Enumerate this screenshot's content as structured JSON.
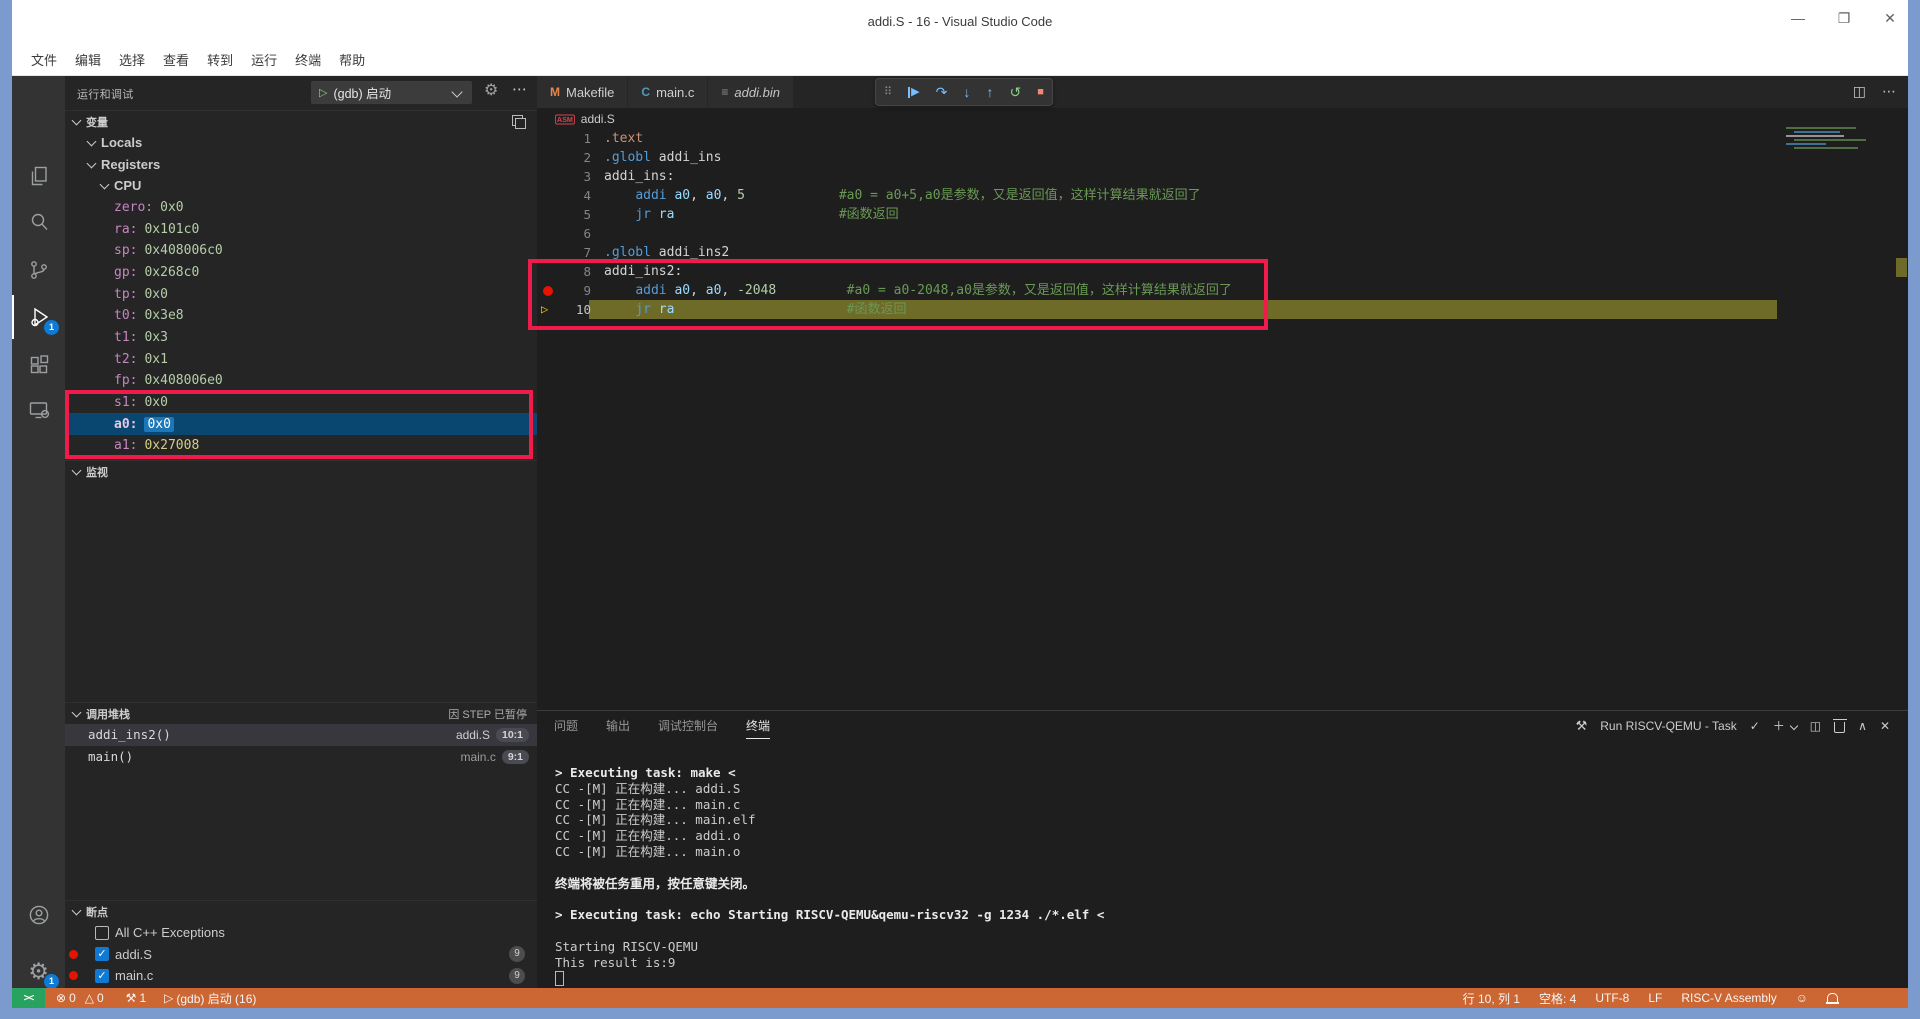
{
  "window": {
    "title": "addi.S - 16 - Visual Studio Code",
    "controls": {
      "minimize": "—",
      "maximize": "❐",
      "close": "✕"
    }
  },
  "menu": [
    "文件",
    "编辑",
    "选择",
    "查看",
    "转到",
    "运行",
    "终端",
    "帮助"
  ],
  "activity_bar": {
    "active": "run-and-debug",
    "debug_badge": "1",
    "settings_badge": "1"
  },
  "sidebar": {
    "title": "运行和调试",
    "launch_config": "(gdb) 启动",
    "variables": {
      "header": "变量",
      "tree": [
        {
          "label": "Locals",
          "depth": 1
        },
        {
          "label": "Registers",
          "depth": 1
        },
        {
          "label": "CPU",
          "depth": 2
        }
      ],
      "registers": [
        {
          "name": "zero",
          "value": "0x0"
        },
        {
          "name": "ra",
          "value": "0x101c0"
        },
        {
          "name": "sp",
          "value": "0x408006c0"
        },
        {
          "name": "gp",
          "value": "0x268c0"
        },
        {
          "name": "tp",
          "value": "0x0"
        },
        {
          "name": "t0",
          "value": "0x3e8"
        },
        {
          "name": "t1",
          "value": "0x3"
        },
        {
          "name": "t2",
          "value": "0x1"
        },
        {
          "name": "fp",
          "value": "0x408006e0"
        },
        {
          "name": "s1",
          "value": "0x0"
        },
        {
          "name": "a0",
          "value": "0x0",
          "selected": true
        },
        {
          "name": "a1",
          "value": "0x27008",
          "changed": true
        }
      ]
    },
    "watch": {
      "header": "监视"
    },
    "call_stack": {
      "header": "调用堆栈",
      "status": "因 STEP 已暂停",
      "frames": [
        {
          "fn": "addi_ins2()",
          "file": "addi.S",
          "pos": "10:1",
          "current": true
        },
        {
          "fn": "main()",
          "file": "main.c",
          "pos": "9:1",
          "current": false
        }
      ]
    },
    "breakpoints": {
      "header": "断点",
      "items": [
        {
          "label": "All C++ Exceptions",
          "checked": false,
          "dot": false,
          "badge": ""
        },
        {
          "label": "addi.S",
          "checked": true,
          "dot": true,
          "badge": "9"
        },
        {
          "label": "main.c",
          "checked": true,
          "dot": true,
          "badge": "9"
        }
      ]
    }
  },
  "editor": {
    "tabs": [
      {
        "label": "Makefile",
        "icon": "M",
        "icon_color": "#e8874a",
        "italic": false
      },
      {
        "label": "main.c",
        "icon": "C",
        "icon_color": "#519aba",
        "italic": false
      },
      {
        "label": "addi.bin",
        "icon": "≡",
        "icon_color": "#8f8f8f",
        "italic": true
      }
    ],
    "breadcrumb": {
      "icon": "ASM",
      "file": "addi.S"
    },
    "code": [
      {
        "n": "1",
        "tokens": [
          [
            ".text",
            "dir"
          ]
        ]
      },
      {
        "n": "2",
        "tokens": [
          [
            ".globl",
            "kw"
          ],
          [
            " addi_ins",
            "lbl"
          ]
        ]
      },
      {
        "n": "3",
        "tokens": [
          [
            "addi_ins:",
            "lbl"
          ]
        ]
      },
      {
        "n": "4",
        "tokens": [
          [
            "    ",
            "plain"
          ],
          [
            "addi",
            "kw"
          ],
          [
            " ",
            "plain"
          ],
          [
            "a0",
            "reg"
          ],
          [
            ", ",
            "plain"
          ],
          [
            "a0",
            "reg"
          ],
          [
            ", ",
            "plain"
          ],
          [
            "5",
            "num"
          ],
          [
            "            ",
            "plain"
          ],
          [
            "#a0 = a0+5,a0是参数，又是返回值，这样计算结果就返回了",
            "cmt"
          ]
        ]
      },
      {
        "n": "5",
        "tokens": [
          [
            "    ",
            "plain"
          ],
          [
            "jr",
            "kw"
          ],
          [
            " ",
            "plain"
          ],
          [
            "ra",
            "reg"
          ],
          [
            "                     ",
            "plain"
          ],
          [
            "#函数返回",
            "cmt"
          ]
        ]
      },
      {
        "n": "6",
        "tokens": []
      },
      {
        "n": "7",
        "tokens": [
          [
            ".globl",
            "kw"
          ],
          [
            " addi_ins2",
            "lbl"
          ]
        ]
      },
      {
        "n": "8",
        "tokens": [
          [
            "addi_ins2:",
            "lbl"
          ]
        ]
      },
      {
        "n": "9",
        "bp": true,
        "tokens": [
          [
            "    ",
            "plain"
          ],
          [
            "addi",
            "kw"
          ],
          [
            " ",
            "plain"
          ],
          [
            "a0",
            "reg"
          ],
          [
            ", ",
            "plain"
          ],
          [
            "a0",
            "reg"
          ],
          [
            ", ",
            "plain"
          ],
          [
            "-2048",
            "num"
          ],
          [
            "         ",
            "plain"
          ],
          [
            "#a0 = a0-2048,a0是参数，又是返回值，这样计算结果就返回了",
            "cmt"
          ]
        ]
      },
      {
        "n": "10",
        "current": true,
        "tokens": [
          [
            "    ",
            "plain"
          ],
          [
            "jr",
            "kw"
          ],
          [
            " ",
            "plain"
          ],
          [
            "ra",
            "reg"
          ],
          [
            "                      ",
            "plain"
          ],
          [
            "#函数返回",
            "cmt"
          ]
        ]
      }
    ]
  },
  "debug_toolbar": {
    "buttons": [
      {
        "name": "drag-handle",
        "glyph": "⠿",
        "cls": "dbg-grip"
      },
      {
        "name": "continue",
        "glyph": "▶",
        "cls": "dbg-blue dbg-continue"
      },
      {
        "name": "step-over",
        "glyph": "↷",
        "cls": "dbg-blue"
      },
      {
        "name": "step-into",
        "glyph": "↓",
        "cls": "dbg-blue"
      },
      {
        "name": "step-out",
        "glyph": "↑",
        "cls": "dbg-blue"
      },
      {
        "name": "restart",
        "glyph": "↺",
        "cls": "dbg-green"
      },
      {
        "name": "stop",
        "glyph": "■",
        "cls": "dbg-red"
      }
    ]
  },
  "panel": {
    "tabs": [
      "问题",
      "输出",
      "调试控制台",
      "终端"
    ],
    "active_tab": "终端",
    "task_label": "Run RISCV-QEMU - Task",
    "tools_icon": "⚒",
    "check_icon": "✓",
    "plus_icon": "＋",
    "split_icon": "◫",
    "collapse_icon": "∧",
    "close_icon": "✕",
    "terminal": [
      {
        "text": "> Executing task: make <",
        "bold": true
      },
      {
        "text": "CC -[M] 正在构建... addi.S"
      },
      {
        "text": "CC -[M] 正在构建... main.c"
      },
      {
        "text": "CC -[M] 正在构建... main.elf"
      },
      {
        "text": "CC -[M] 正在构建... addi.o"
      },
      {
        "text": "CC -[M] 正在构建... main.o"
      },
      {
        "text": ""
      },
      {
        "text": "终端将被任务重用，按任意键关闭。",
        "bold": true
      },
      {
        "text": ""
      },
      {
        "text": "> Executing task: echo Starting RISCV-QEMU&qemu-riscv32 -g 1234 ./*.elf <",
        "bold": true
      },
      {
        "text": ""
      },
      {
        "text": "Starting RISCV-QEMU"
      },
      {
        "text": "This result is:9"
      },
      {
        "text": "",
        "cursor": true
      }
    ]
  },
  "status_bar": {
    "remote": "><",
    "errors_icon": "⊗",
    "errors": "0",
    "warnings_icon": "△",
    "warnings": "0",
    "tools_icon": "⚒",
    "tasks": "1",
    "debug_icon": "▷",
    "debug": "(gdb) 启动 (16)",
    "line_col": "行 10, 列 1",
    "spaces": "空格: 4",
    "encoding": "UTF-8",
    "eol": "LF",
    "language": "RISC-V Assembly",
    "feedback_icon": "☺"
  },
  "colors": {
    "annotation_red": "#ee1b4b",
    "statusbar_orange": "#cc6633",
    "remote_green": "#27a35f",
    "selection_blue": "#094771",
    "badge_blue": "#0e7ad3",
    "current_line_olive": "#6e6a28"
  }
}
